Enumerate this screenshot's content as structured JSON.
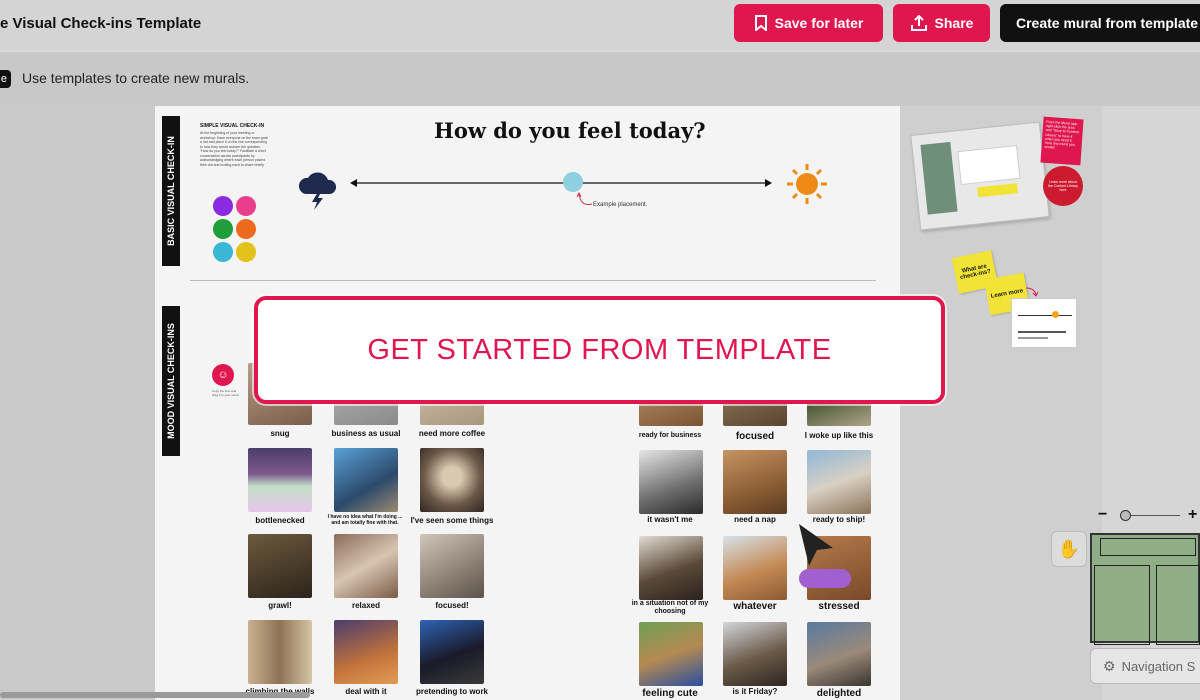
{
  "header": {
    "title": "e Visual Check-ins Template",
    "save_label": "Save for later",
    "share_label": "Share",
    "create_label": "Create mural from template"
  },
  "infobar": {
    "badge": "e",
    "text": "Use templates to create new murals."
  },
  "board": {
    "basic_label": "BASIC VISUAL CHECK-IN",
    "mood_label": "MOOD VISUAL CHECK-INS",
    "simple_title": "SIMPLE VISUAL CHECK-IN",
    "simple_text": "At the beginning of your meeting or workshop: Have everyone on the team grab a dot and place it on the line corresponding to how they would answer the question \"How do you feel today?\" Facilitate a short conversation across participants by acknowledging where each person placed their dot and inviting each to share briefly.",
    "feel_title": "How do you feel today?",
    "example_label": "Example placement.",
    "pin_text": "Copy the icon and drag it to your mood",
    "dot_colors": [
      "#8a2be2",
      "#e83e8c",
      "#1f9e3a",
      "#ec6a1e",
      "#3bb7d6",
      "#e2c21b"
    ],
    "left_captions": [
      [
        "snug",
        "business as usual",
        "need more coffee"
      ],
      [
        "bottlenecked",
        "I have no idea what I'm doing ... and am totally fine with that.",
        "I've seen some things"
      ],
      [
        "grawl!",
        "relaxed",
        "focused!"
      ],
      [
        "climbing the walls",
        "deal with it",
        "pretending to work"
      ]
    ],
    "right_captions": [
      [
        "ready for business",
        "focused",
        "I woke up like this"
      ],
      [
        "it wasn't me",
        "need a nap",
        "ready to ship!"
      ],
      [
        "in a situation not of my choosing",
        "whatever",
        "stressed"
      ],
      [
        "feeling cute",
        "is it Friday?",
        "delighted"
      ]
    ]
  },
  "banner": {
    "text": "GET STARTED FROM TEMPLATE"
  },
  "side_panel": {
    "sticky1": "What are check-ins?",
    "sticky2": "Learn more",
    "red_note": "From the Mural app, right-click the area and \"Save to Content Library\" to have it when you need it from any mural you create!",
    "circle_note": "Learn more about the Content Library here"
  },
  "controls": {
    "zoom_minus": "−",
    "zoom_plus": "+",
    "nav_label": "Navigation S"
  }
}
